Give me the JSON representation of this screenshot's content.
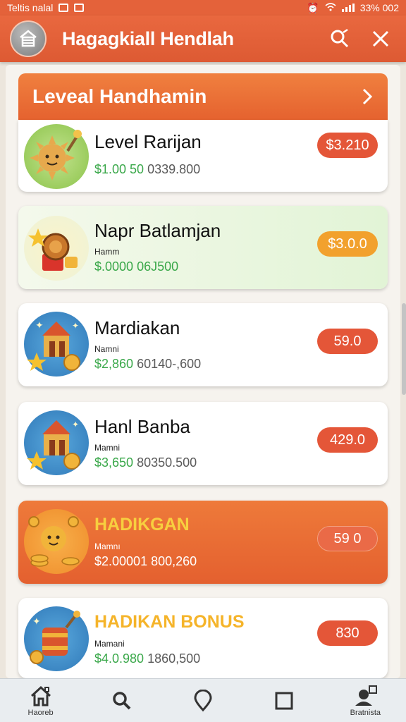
{
  "status_bar": {
    "left_text": "Teltis nalal",
    "right_text": "33% 002"
  },
  "app_bar": {
    "title": "Hagagkiall Hendlah"
  },
  "section": {
    "title": "Leveal Handhamin"
  },
  "items": [
    {
      "name": "Level Rarijan",
      "sub": "",
      "price_green": "$1.00 50",
      "price_gray": "0339.800",
      "badge": "$3.210"
    },
    {
      "name": "Napr Batlamjan",
      "sub": "Hamm",
      "price_green": "$.0000",
      "price_gray": "06J500",
      "badge": "$3.0.0"
    },
    {
      "name": "Mardiakan",
      "sub": "Namni",
      "price_green": "$2,860",
      "price_gray": "60140-,600",
      "badge": "59.0"
    },
    {
      "name": "Hanl Banba",
      "sub": "Mamni",
      "price_green": "$3,650",
      "price_gray": "80350.500",
      "badge": "429.0"
    },
    {
      "name": "HADIKGAN",
      "sub": "Mamnı",
      "price_green": "$2.00001",
      "price_gray": "800,260",
      "badge": "59 0"
    },
    {
      "name": "HADIKAN BONUS",
      "sub": "Mamani",
      "price_green": "$4.0.980",
      "price_gray": "1860,500",
      "badge": "830"
    }
  ],
  "bottom_nav": [
    {
      "label": "Haoreb",
      "icon": "home-icon"
    },
    {
      "label": "",
      "icon": "search-icon"
    },
    {
      "label": "",
      "icon": "location-icon"
    },
    {
      "label": "",
      "icon": "square-icon"
    },
    {
      "label": "Bratnista",
      "icon": "profile-icon"
    }
  ],
  "colors": {
    "accent": "#e4623a",
    "green": "#3aa84a",
    "badge_red": "#e45638",
    "badge_gold": "#f2a12d"
  }
}
